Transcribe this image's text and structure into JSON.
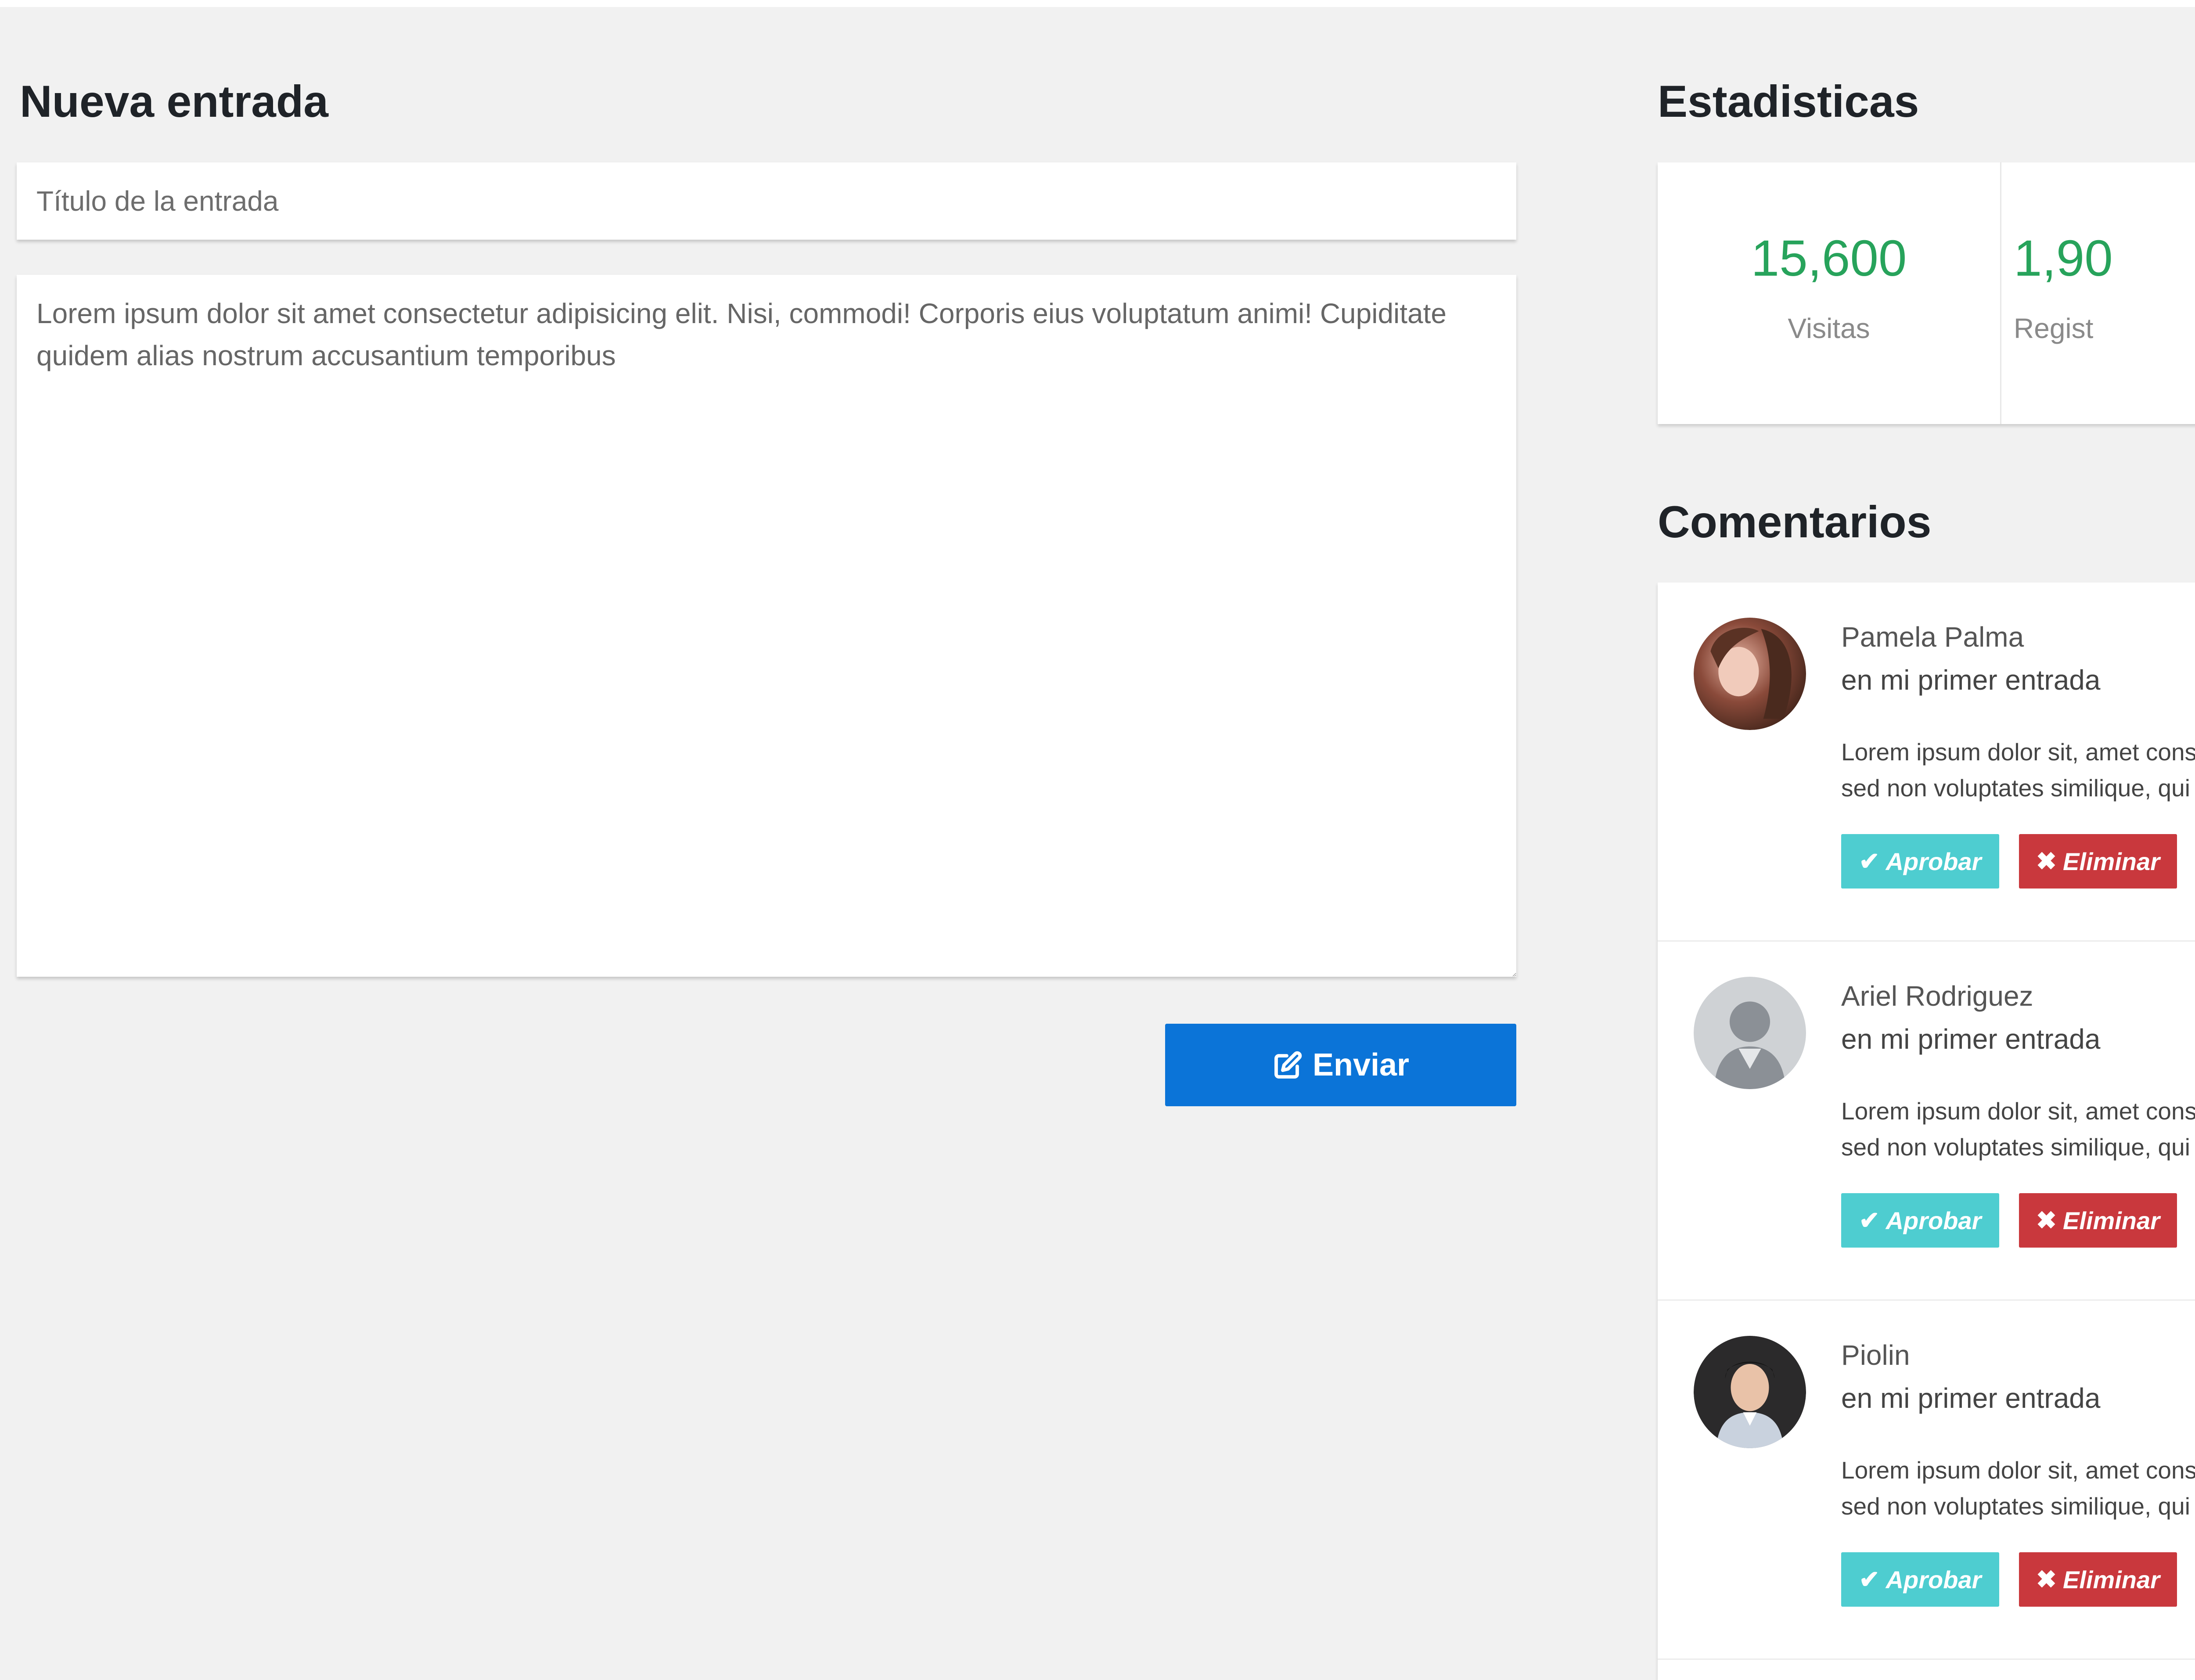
{
  "new_entry": {
    "heading": "Nueva entrada",
    "title_placeholder": "Título de la entrada",
    "body_text": "Lorem ipsum dolor sit amet consectetur adipisicing elit. Nisi, commodi! Corporis eius voluptatum animi! Cupiditate quidem alias nostrum accusantium temporibus",
    "send_label": "Enviar",
    "send_icon": "edit-icon"
  },
  "stats": {
    "heading": "Estadisticas",
    "items": [
      {
        "value": "15,600",
        "label": "Visitas"
      },
      {
        "value": "1,90",
        "label": "Regist"
      }
    ],
    "value_color": "#27a35b"
  },
  "comments": {
    "heading": "Comentarios",
    "items": [
      {
        "name": "Pamela Palma",
        "post": "en mi primer entrada",
        "text_line1": "Lorem ipsum dolor sit, amet cons",
        "text_line2": "sed non voluptates similique, qui",
        "approve_label": "Aprobar",
        "delete_label": "Eliminar"
      },
      {
        "name": "Ariel Rodriguez",
        "post": "en mi primer entrada",
        "text_line1": "Lorem ipsum dolor sit, amet cons",
        "text_line2": "sed non voluptates similique, qui",
        "approve_label": "Aprobar",
        "delete_label": "Eliminar"
      },
      {
        "name": "Piolin",
        "post": "en mi primer entrada",
        "text_line1": "Lorem ipsum dolor sit, amet cons",
        "text_line2": "sed non voluptates similique, qui",
        "approve_label": "Aprobar",
        "delete_label": "Eliminar"
      }
    ],
    "approve_color": "#4ecdd0",
    "delete_color": "#c9383d",
    "send_color": "#0b74d8"
  }
}
